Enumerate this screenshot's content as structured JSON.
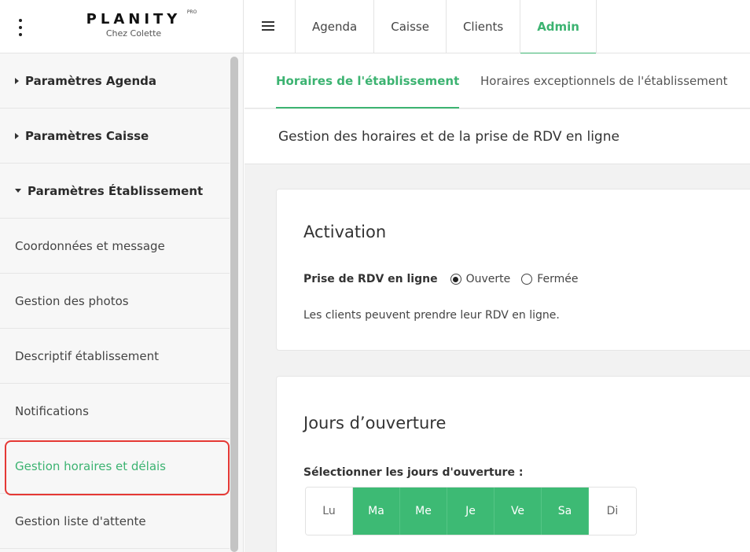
{
  "brand": {
    "name": "PLANITY",
    "superscript": "PRO",
    "subtitle": "Chez Colette"
  },
  "topnav": {
    "tabs": [
      {
        "label": "Agenda"
      },
      {
        "label": "Caisse"
      },
      {
        "label": "Clients"
      },
      {
        "label": "Admin"
      }
    ],
    "active_tab": "Admin"
  },
  "sidebar": {
    "items": [
      {
        "label": "Paramètres Agenda",
        "kind": "section-collapsed"
      },
      {
        "label": "Paramètres Caisse",
        "kind": "section-collapsed"
      },
      {
        "label": "Paramètres Établissement",
        "kind": "section-expanded"
      },
      {
        "label": "Coordonnées et message",
        "kind": "item"
      },
      {
        "label": "Gestion des photos",
        "kind": "item"
      },
      {
        "label": "Descriptif établissement",
        "kind": "item"
      },
      {
        "label": "Notifications",
        "kind": "item"
      },
      {
        "label": "Gestion horaires et délais",
        "kind": "item-active"
      },
      {
        "label": "Gestion liste d'attente",
        "kind": "item"
      }
    ]
  },
  "subtabs": [
    {
      "label": "Horaires de l'établissement"
    },
    {
      "label": "Horaires exceptionnels de l'établissement"
    }
  ],
  "page_header": "Gestion des horaires et de la prise de RDV en ligne",
  "activation": {
    "title": "Activation",
    "field_label": "Prise de RDV en ligne",
    "options": [
      {
        "label": "Ouverte"
      },
      {
        "label": "Fermée"
      }
    ],
    "selected": "Ouverte",
    "helper": "Les clients peuvent prendre leur RDV en ligne."
  },
  "jours": {
    "title": "Jours d’ouverture",
    "select_label": "Sélectionner les jours d'ouverture :",
    "days": [
      {
        "label": "Lu",
        "open": false
      },
      {
        "label": "Ma",
        "open": true
      },
      {
        "label": "Me",
        "open": true
      },
      {
        "label": "Je",
        "open": true
      },
      {
        "label": "Ve",
        "open": true
      },
      {
        "label": "Sa",
        "open": true
      },
      {
        "label": "Di",
        "open": false
      }
    ]
  },
  "colors": {
    "accent": "#3cb371",
    "highlight": "#e53935"
  }
}
